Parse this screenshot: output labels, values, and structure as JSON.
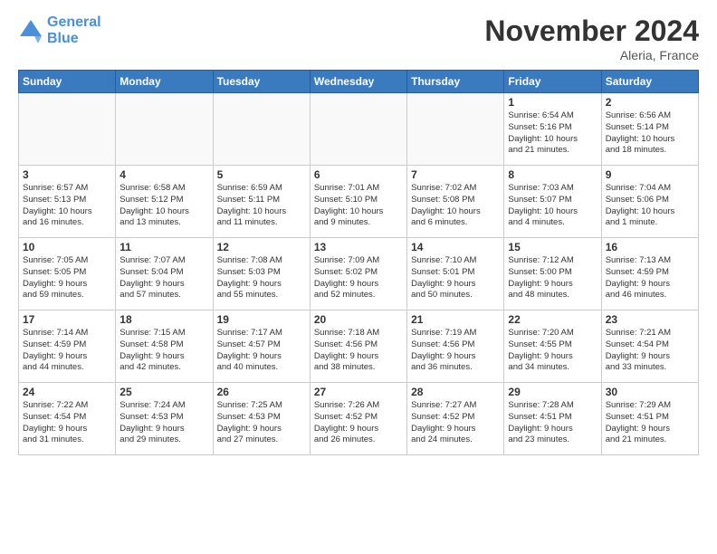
{
  "logo": {
    "line1": "General",
    "line2": "Blue"
  },
  "title": "November 2024",
  "location": "Aleria, France",
  "days_of_week": [
    "Sunday",
    "Monday",
    "Tuesday",
    "Wednesday",
    "Thursday",
    "Friday",
    "Saturday"
  ],
  "weeks": [
    [
      {
        "day": "",
        "info": "",
        "empty": true
      },
      {
        "day": "",
        "info": "",
        "empty": true
      },
      {
        "day": "",
        "info": "",
        "empty": true
      },
      {
        "day": "",
        "info": "",
        "empty": true
      },
      {
        "day": "",
        "info": "",
        "empty": true
      },
      {
        "day": "1",
        "info": "Sunrise: 6:54 AM\nSunset: 5:16 PM\nDaylight: 10 hours\nand 21 minutes.",
        "empty": false
      },
      {
        "day": "2",
        "info": "Sunrise: 6:56 AM\nSunset: 5:14 PM\nDaylight: 10 hours\nand 18 minutes.",
        "empty": false
      }
    ],
    [
      {
        "day": "3",
        "info": "Sunrise: 6:57 AM\nSunset: 5:13 PM\nDaylight: 10 hours\nand 16 minutes.",
        "empty": false
      },
      {
        "day": "4",
        "info": "Sunrise: 6:58 AM\nSunset: 5:12 PM\nDaylight: 10 hours\nand 13 minutes.",
        "empty": false
      },
      {
        "day": "5",
        "info": "Sunrise: 6:59 AM\nSunset: 5:11 PM\nDaylight: 10 hours\nand 11 minutes.",
        "empty": false
      },
      {
        "day": "6",
        "info": "Sunrise: 7:01 AM\nSunset: 5:10 PM\nDaylight: 10 hours\nand 9 minutes.",
        "empty": false
      },
      {
        "day": "7",
        "info": "Sunrise: 7:02 AM\nSunset: 5:08 PM\nDaylight: 10 hours\nand 6 minutes.",
        "empty": false
      },
      {
        "day": "8",
        "info": "Sunrise: 7:03 AM\nSunset: 5:07 PM\nDaylight: 10 hours\nand 4 minutes.",
        "empty": false
      },
      {
        "day": "9",
        "info": "Sunrise: 7:04 AM\nSunset: 5:06 PM\nDaylight: 10 hours\nand 1 minute.",
        "empty": false
      }
    ],
    [
      {
        "day": "10",
        "info": "Sunrise: 7:05 AM\nSunset: 5:05 PM\nDaylight: 9 hours\nand 59 minutes.",
        "empty": false
      },
      {
        "day": "11",
        "info": "Sunrise: 7:07 AM\nSunset: 5:04 PM\nDaylight: 9 hours\nand 57 minutes.",
        "empty": false
      },
      {
        "day": "12",
        "info": "Sunrise: 7:08 AM\nSunset: 5:03 PM\nDaylight: 9 hours\nand 55 minutes.",
        "empty": false
      },
      {
        "day": "13",
        "info": "Sunrise: 7:09 AM\nSunset: 5:02 PM\nDaylight: 9 hours\nand 52 minutes.",
        "empty": false
      },
      {
        "day": "14",
        "info": "Sunrise: 7:10 AM\nSunset: 5:01 PM\nDaylight: 9 hours\nand 50 minutes.",
        "empty": false
      },
      {
        "day": "15",
        "info": "Sunrise: 7:12 AM\nSunset: 5:00 PM\nDaylight: 9 hours\nand 48 minutes.",
        "empty": false
      },
      {
        "day": "16",
        "info": "Sunrise: 7:13 AM\nSunset: 4:59 PM\nDaylight: 9 hours\nand 46 minutes.",
        "empty": false
      }
    ],
    [
      {
        "day": "17",
        "info": "Sunrise: 7:14 AM\nSunset: 4:59 PM\nDaylight: 9 hours\nand 44 minutes.",
        "empty": false
      },
      {
        "day": "18",
        "info": "Sunrise: 7:15 AM\nSunset: 4:58 PM\nDaylight: 9 hours\nand 42 minutes.",
        "empty": false
      },
      {
        "day": "19",
        "info": "Sunrise: 7:17 AM\nSunset: 4:57 PM\nDaylight: 9 hours\nand 40 minutes.",
        "empty": false
      },
      {
        "day": "20",
        "info": "Sunrise: 7:18 AM\nSunset: 4:56 PM\nDaylight: 9 hours\nand 38 minutes.",
        "empty": false
      },
      {
        "day": "21",
        "info": "Sunrise: 7:19 AM\nSunset: 4:56 PM\nDaylight: 9 hours\nand 36 minutes.",
        "empty": false
      },
      {
        "day": "22",
        "info": "Sunrise: 7:20 AM\nSunset: 4:55 PM\nDaylight: 9 hours\nand 34 minutes.",
        "empty": false
      },
      {
        "day": "23",
        "info": "Sunrise: 7:21 AM\nSunset: 4:54 PM\nDaylight: 9 hours\nand 33 minutes.",
        "empty": false
      }
    ],
    [
      {
        "day": "24",
        "info": "Sunrise: 7:22 AM\nSunset: 4:54 PM\nDaylight: 9 hours\nand 31 minutes.",
        "empty": false
      },
      {
        "day": "25",
        "info": "Sunrise: 7:24 AM\nSunset: 4:53 PM\nDaylight: 9 hours\nand 29 minutes.",
        "empty": false
      },
      {
        "day": "26",
        "info": "Sunrise: 7:25 AM\nSunset: 4:53 PM\nDaylight: 9 hours\nand 27 minutes.",
        "empty": false
      },
      {
        "day": "27",
        "info": "Sunrise: 7:26 AM\nSunset: 4:52 PM\nDaylight: 9 hours\nand 26 minutes.",
        "empty": false
      },
      {
        "day": "28",
        "info": "Sunrise: 7:27 AM\nSunset: 4:52 PM\nDaylight: 9 hours\nand 24 minutes.",
        "empty": false
      },
      {
        "day": "29",
        "info": "Sunrise: 7:28 AM\nSunset: 4:51 PM\nDaylight: 9 hours\nand 23 minutes.",
        "empty": false
      },
      {
        "day": "30",
        "info": "Sunrise: 7:29 AM\nSunset: 4:51 PM\nDaylight: 9 hours\nand 21 minutes.",
        "empty": false
      }
    ]
  ]
}
